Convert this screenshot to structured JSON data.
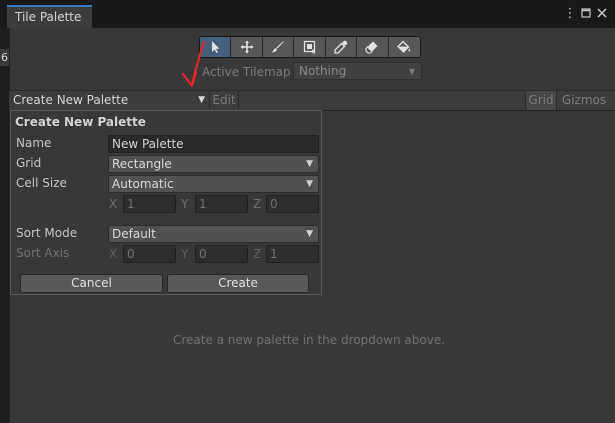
{
  "window": {
    "tab_title": "Tile Palette",
    "menu_icon": "more-vertical-icon",
    "maximize_icon": "maximize-icon",
    "close_icon": "close-icon",
    "edge_label": "6"
  },
  "tools": [
    {
      "name": "select-tool",
      "icon": "cursor-arrow-icon",
      "active": true
    },
    {
      "name": "move-tool",
      "icon": "move-arrows-icon",
      "active": false
    },
    {
      "name": "paint-tool",
      "icon": "paintbrush-icon",
      "active": false
    },
    {
      "name": "box-fill-tool",
      "icon": "box-fill-icon",
      "active": false
    },
    {
      "name": "picker-tool",
      "icon": "eyedropper-icon",
      "active": false
    },
    {
      "name": "erase-tool",
      "icon": "eraser-icon",
      "active": false
    },
    {
      "name": "fill-tool",
      "icon": "paint-bucket-icon",
      "active": false
    }
  ],
  "active_tilemap": {
    "label": "Active Tilemap",
    "value": "Nothing"
  },
  "palette_bar": {
    "palette_select": "Create New Palette",
    "edit_label": "Edit",
    "grid_label": "Grid",
    "gizmos_label": "Gizmos"
  },
  "popup": {
    "title": "Create New Palette",
    "name_label": "Name",
    "name_value": "New Palette",
    "grid_label": "Grid",
    "grid_value": "Rectangle",
    "cell_size_label": "Cell Size",
    "cell_size_value": "Automatic",
    "cell": {
      "x_label": "X",
      "x": "1",
      "y_label": "Y",
      "y": "1",
      "z_label": "Z",
      "z": "0"
    },
    "sort_mode_label": "Sort Mode",
    "sort_mode_value": "Default",
    "sort_axis_label": "Sort Axis",
    "sort": {
      "x_label": "X",
      "x": "0",
      "y_label": "Y",
      "y": "0",
      "z_label": "Z",
      "z": "1"
    },
    "cancel_label": "Cancel",
    "create_label": "Create"
  },
  "hint": "Create a new palette in the dropdown above.",
  "colors": {
    "accent_tab": "#3a79bb",
    "active_tool": "#46607c",
    "annotation": "#e0282c"
  }
}
